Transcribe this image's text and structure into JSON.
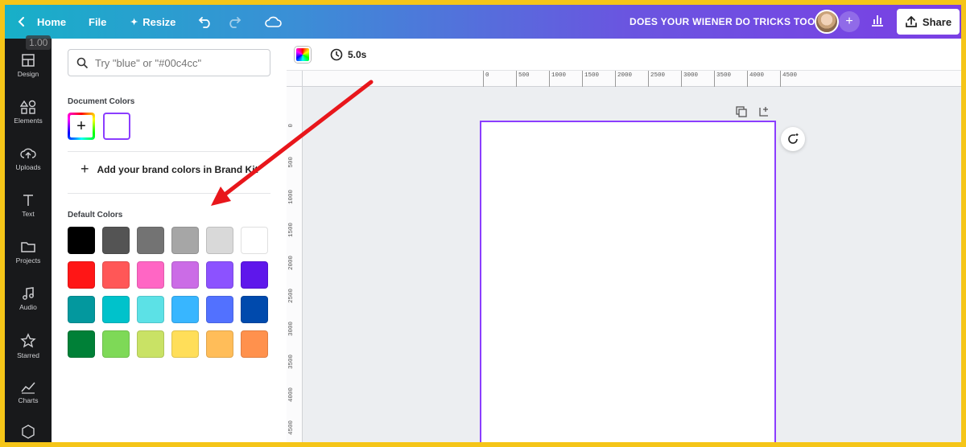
{
  "topbar": {
    "home_label": "Home",
    "file_label": "File",
    "resize_label": "Resize",
    "title": "DOES YOUR WIENER DO TRICKS TOO?",
    "share_label": "Share"
  },
  "rail": {
    "zoom": "1.00",
    "items": [
      {
        "label": "Design",
        "icon": "layout-icon"
      },
      {
        "label": "Elements",
        "icon": "shapes-icon"
      },
      {
        "label": "Uploads",
        "icon": "cloud-upload-icon"
      },
      {
        "label": "Text",
        "icon": "text-icon"
      },
      {
        "label": "Projects",
        "icon": "folder-icon"
      },
      {
        "label": "Audio",
        "icon": "music-icon"
      },
      {
        "label": "Starred",
        "icon": "star-icon"
      },
      {
        "label": "Charts",
        "icon": "chart-icon"
      }
    ]
  },
  "panel": {
    "search_placeholder": "Try \"blue\" or \"#00c4cc\"",
    "document_colors_title": "Document Colors",
    "brand_kit_label": "Add your brand colors in Brand Kit",
    "default_colors_title": "Default Colors",
    "default_colors": [
      "#000000",
      "#545454",
      "#737373",
      "#a6a6a6",
      "#d9d9d9",
      "#ffffff",
      "#ff1616",
      "#ff5757",
      "#ff66c4",
      "#cb6ce6",
      "#8c52ff",
      "#5e17eb",
      "#03989e",
      "#00c2cb",
      "#5ce1e6",
      "#38b6ff",
      "#5271ff",
      "#004aad",
      "#008037",
      "#7ed957",
      "#c9e265",
      "#ffde59",
      "#ffbd59",
      "#ff914d"
    ]
  },
  "workspace": {
    "duration": "5.0s",
    "ruler_top": [
      "0",
      "500",
      "1000",
      "1500",
      "2000",
      "2500",
      "3000",
      "3500",
      "4000",
      "4500"
    ],
    "ruler_left": [
      "0",
      "500",
      "1000",
      "1500",
      "2000",
      "2500",
      "3000",
      "3500",
      "4000",
      "4500"
    ]
  },
  "colors": {
    "accent": "#8b3dff",
    "annotation_arrow": "#e8161b"
  }
}
